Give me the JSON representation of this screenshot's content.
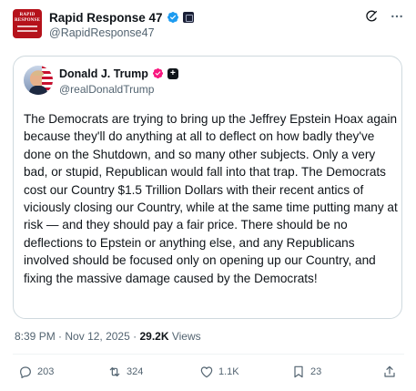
{
  "retweeter": {
    "name": "Rapid Response 47",
    "handle": "@RapidResponse47",
    "avatar_label": "RAPID RESPONSE"
  },
  "header_icons": [
    "grok-icon",
    "more-icon"
  ],
  "quoted_post": {
    "author_name": "Donald J. Trump",
    "author_handle": "@realDonaldTrump",
    "badge_plus": "+",
    "body": "The Democrats are trying to bring up the Jeffrey Epstein Hoax again because they'll do anything at all to deflect on how badly they've done on the Shutdown, and so many other subjects. Only a very bad, or stupid, Republican would fall into that trap. The Democrats cost our Country $1.5 Trillion Dollars with their recent antics of viciously closing our Country, while at the same time putting many at risk — and they should pay a fair price. There should be no deflections to Epstein or anything else, and any Republicans involved should be focused only on opening up our Country, and fixing the massive damage caused by the Democrats!"
  },
  "meta": {
    "time": "8:39 PM",
    "separator": "·",
    "date": "Nov 12, 2025",
    "views_count": "29.2K",
    "views_label": "Views"
  },
  "actions": {
    "replies": "203",
    "reposts": "324",
    "likes": "1.1K",
    "bookmarks": "23"
  },
  "colors": {
    "text": "#0f1419",
    "secondary": "#536471",
    "border": "#cfd9de",
    "verified_blue": "#1d9bf0",
    "pink_badge": "#f91880"
  }
}
